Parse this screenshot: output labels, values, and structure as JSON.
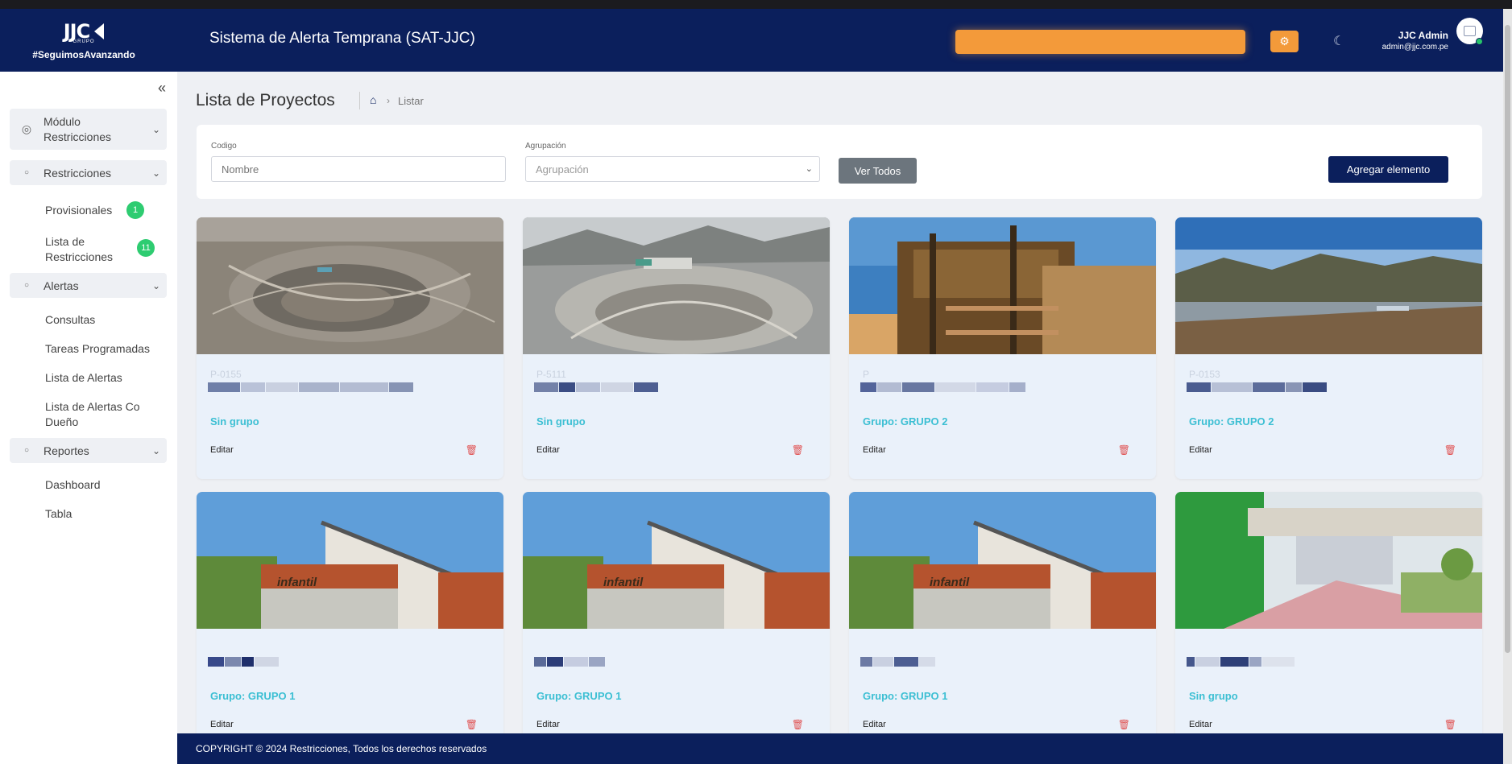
{
  "header": {
    "logo_text": "JJC",
    "logo_sub": "GRUPO",
    "tagline": "#SeguimosAvanzando",
    "app_title": "Sistema de Alerta Temprana (SAT-JJC)",
    "user_name": "JJC Admin",
    "user_email": "admin@jjc.com.pe",
    "accent_color": "#f39a3a",
    "brand_color": "#0b1f5c"
  },
  "sidebar": {
    "sections": [
      {
        "label": "Módulo Restricciones"
      },
      {
        "label": "Restricciones"
      },
      {
        "label": "Alertas"
      },
      {
        "label": "Reportes"
      }
    ],
    "restricciones_items": [
      {
        "label": "Provisionales",
        "badge": "1"
      },
      {
        "label": "Lista de Restricciones",
        "badge": "11"
      }
    ],
    "alertas_items": [
      {
        "label": "Consultas"
      },
      {
        "label": "Tareas Programadas"
      },
      {
        "label": "Lista de Alertas"
      },
      {
        "label": "Lista de Alertas Co Dueño"
      }
    ],
    "reportes_items": [
      {
        "label": "Dashboard"
      },
      {
        "label": "Tabla"
      }
    ]
  },
  "page": {
    "title": "Lista de Proyectos",
    "breadcrumb_current": "Listar"
  },
  "filters": {
    "codigo_label": "Codigo",
    "codigo_placeholder": "Nombre",
    "agrupacion_label": "Agrupación",
    "agrupacion_value": "Agrupación",
    "ver_todos": "Ver Todos",
    "agregar": "Agregar elemento"
  },
  "projects": [
    {
      "code": "P-0155",
      "group": "Sin grupo",
      "edit": "Editar"
    },
    {
      "code": "P-5111",
      "group": "Sin grupo",
      "edit": "Editar"
    },
    {
      "code": "P",
      "group": "Grupo: GRUPO 2",
      "edit": "Editar"
    },
    {
      "code": "P-0153",
      "group": "Grupo: GRUPO 2",
      "edit": "Editar"
    },
    {
      "code": "",
      "group": "Grupo: GRUPO 1",
      "edit": "Editar"
    },
    {
      "code": "",
      "group": "Grupo: GRUPO 1",
      "edit": "Editar"
    },
    {
      "code": "",
      "group": "Grupo: GRUPO 1",
      "edit": "Editar"
    },
    {
      "code": "",
      "group": "Sin grupo",
      "edit": "Editar"
    }
  ],
  "footer": {
    "copyright": "COPYRIGHT © 2024  Restricciones, Todos los derechos reservados"
  }
}
